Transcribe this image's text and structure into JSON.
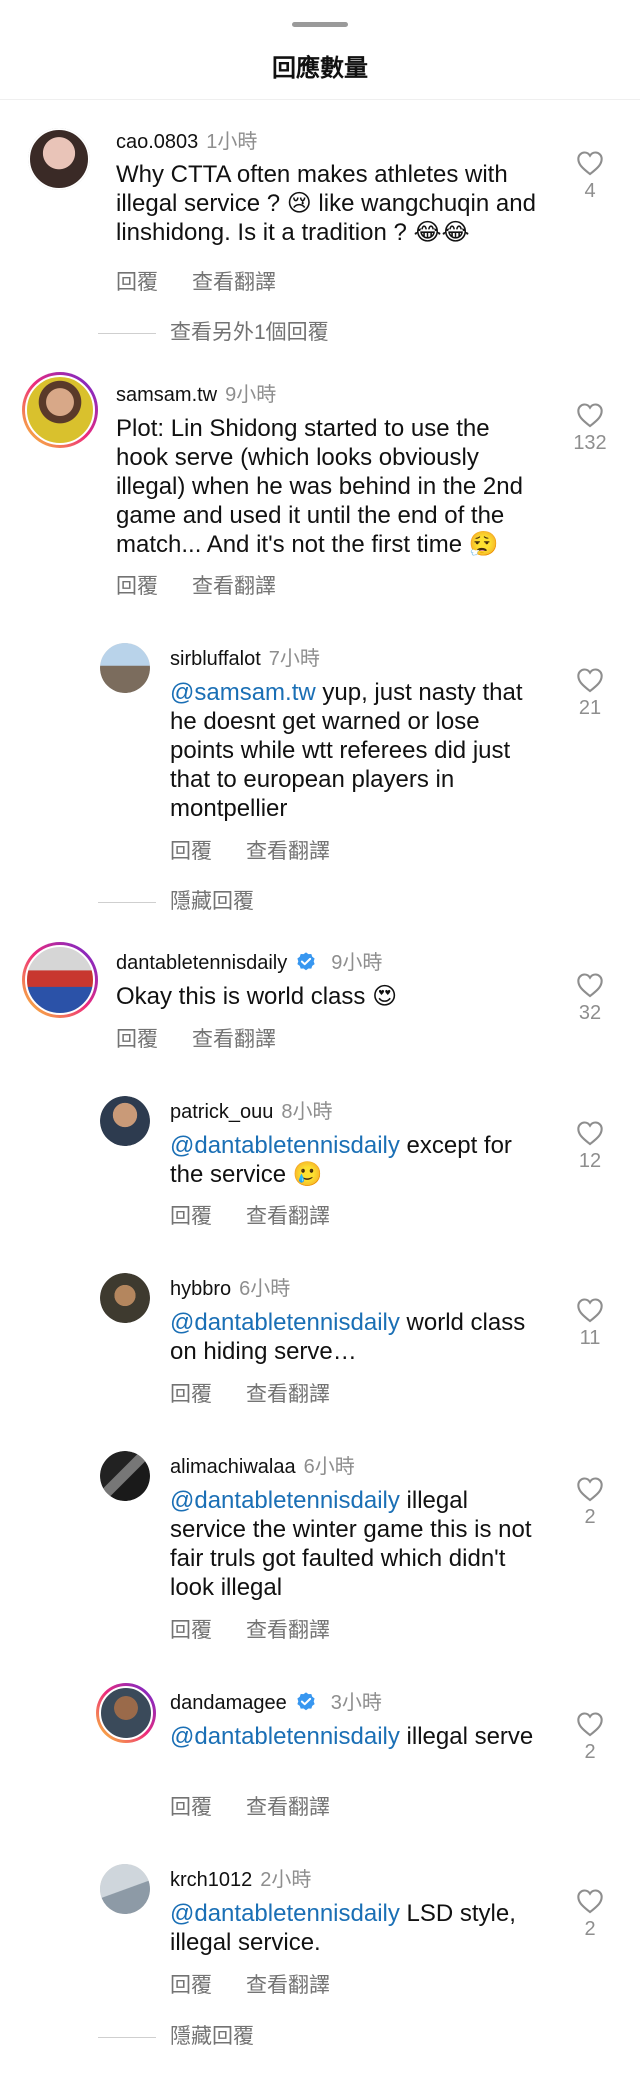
{
  "header": {
    "title": "回應數量"
  },
  "actions": {
    "reply": "回覆",
    "translate": "查看翻譯"
  },
  "comments": [
    {
      "user": "cao.0803",
      "time": "1小時",
      "text": "Why CTTA often makes athletes with illegal service ? 😢 like wangchuqin and linshidong. Is it a tradition ? 😂😂",
      "likes": "4"
    },
    {
      "user": "samsam.tw",
      "time": "9小時",
      "text": "Plot: Lin Shidong started to use the hook serve (which looks obviously illegal) when he was behind in the 2nd game and used it until the end of the match... And it's not the first time 😮‍💨",
      "likes": "132"
    },
    {
      "user": "sirbluffalot",
      "time": "7小時",
      "mention": "@samsam.tw",
      "text": " yup, just nasty that he doesnt get warned or lose points while wtt referees did just that to european players in montpellier",
      "likes": "21"
    },
    {
      "user": "dantabletennisdaily",
      "time": "9小時",
      "text": "Okay this is world class 😍",
      "likes": "32",
      "verified": true
    },
    {
      "user": "patrick_ouu",
      "time": "8小時",
      "mention": "@dantabletennisdaily",
      "text": " except for the service 🥲",
      "likes": "12"
    },
    {
      "user": "hybbro",
      "time": "6小時",
      "mention": "@dantabletennisdaily",
      "text": " world class on hiding serve…",
      "likes": "11"
    },
    {
      "user": "alimachiwalaa",
      "time": "6小時",
      "mention": "@dantabletennisdaily",
      "text": " illegal service the winter game this is not fair truls got faulted which didn't look illegal",
      "likes": "2"
    },
    {
      "user": "dandamagee",
      "time": "3小時",
      "mention": "@dantabletennisdaily",
      "text": " illegal serve",
      "likes": "2",
      "verified": true
    },
    {
      "user": "krch1012",
      "time": "2小時",
      "mention": "@dantabletennisdaily",
      "text": " LSD style, illegal service.",
      "likes": "2"
    }
  ],
  "threads": {
    "view_more_1": "查看另外1個回覆",
    "hide_replies_1": "隱藏回覆",
    "hide_replies_2": "隱藏回覆"
  },
  "colors": {
    "mention": "#1a6fb5",
    "verified": "#3897f0",
    "muted": "#737373"
  }
}
